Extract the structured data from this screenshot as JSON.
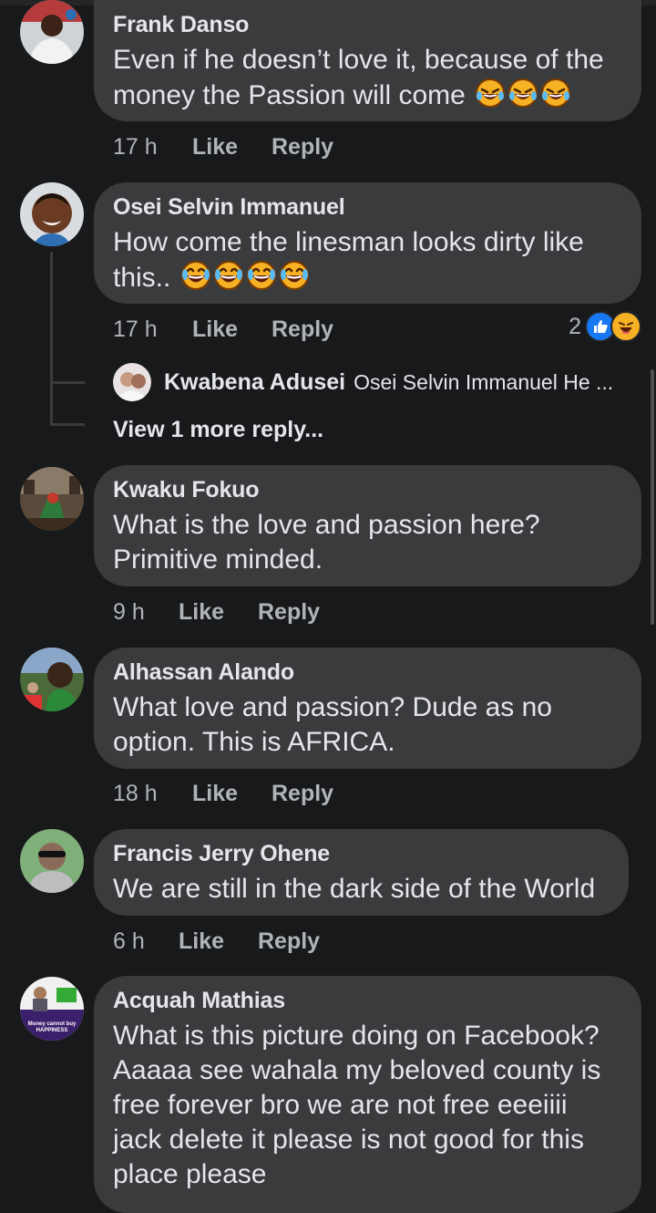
{
  "comments": [
    {
      "author": "Frank Danso",
      "text": "Even if he doesn’t love it, because of the money the Passion will come",
      "time": "17 h",
      "like": "Like",
      "reply": "Reply"
    },
    {
      "author": "Osei Selvin Immanuel",
      "text": "How come the linesman looks dirty like this..",
      "time": "17 h",
      "like": "Like",
      "reply": "Reply",
      "reaction_count": "2",
      "replies": {
        "author": "Kwabena Adusei",
        "preview": "Osei Selvin Immanuel He ...",
        "view_more": "View 1 more reply..."
      }
    },
    {
      "author": "Kwaku Fokuo",
      "text": "What is the love and passion here? Primitive minded.",
      "time": "9 h",
      "like": "Like",
      "reply": "Reply"
    },
    {
      "author": "Alhassan Alando",
      "text": "What love and passion? Dude as no option. This is AFRICA.",
      "time": "18 h",
      "like": "Like",
      "reply": "Reply"
    },
    {
      "author": "Francis Jerry Ohene",
      "text": "We are still in the dark side of the World",
      "time": "6 h",
      "like": "Like",
      "reply": "Reply"
    },
    {
      "author": "Acquah Mathias",
      "text": "What is this picture doing on Facebook? Aaaaa see wahala my beloved county is free forever bro we are not free eeeiiii jack delete it please is not good for this place please",
      "avatar_caption": "Money cannot buy HAPPINESS"
    }
  ],
  "colors": {
    "background": "#18191a",
    "bubble": "#3a3b3c",
    "text": "#e4e6eb",
    "muted": "#b0b3b8",
    "like_blue": "#1877f2",
    "haha_yellow": "#f7b125"
  },
  "icons": {
    "laughing_emoji": "rolling-on-floor-laughing-icon",
    "tears_emoji": "face-with-tears-of-joy-icon",
    "like_reaction": "thumbs-up-icon",
    "haha_reaction": "haha-icon"
  }
}
